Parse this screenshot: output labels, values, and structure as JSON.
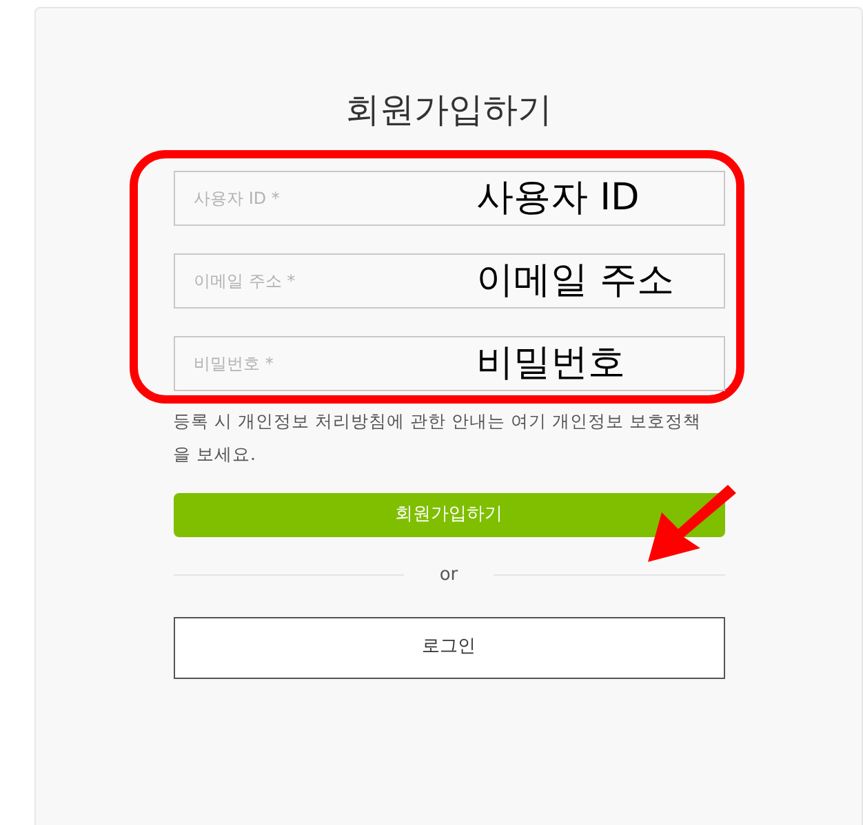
{
  "title": "회원가입하기",
  "fields": [
    {
      "placeholder": "사용자 ID *",
      "annotation": "사용자 ID"
    },
    {
      "placeholder": "이메일 주소 *",
      "annotation": "이메일 주소"
    },
    {
      "placeholder": "비밀번호 *",
      "annotation": "비밀번호"
    }
  ],
  "notice": "등록 시 개인정보 처리방침에 관한 안내는 여기 개인정보 보호정책을 보세요.",
  "signup_button": "회원가입하기",
  "divider_text": "or",
  "login_button": "로그인"
}
